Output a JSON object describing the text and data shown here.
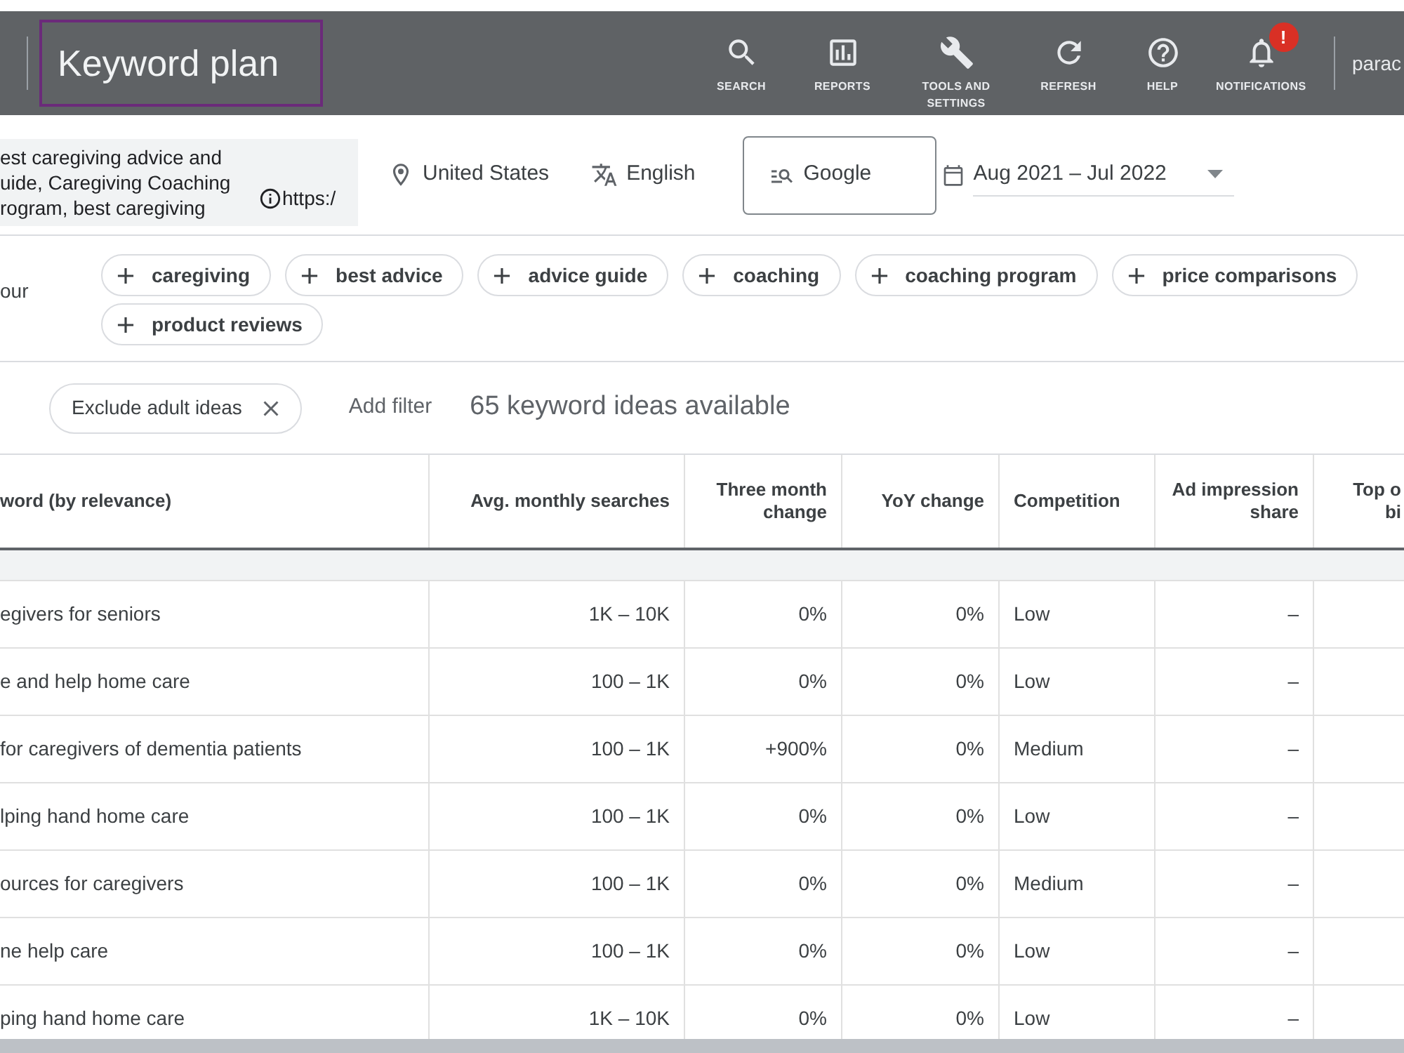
{
  "header": {
    "title": "Keyword plan",
    "nav": [
      {
        "kind": "search",
        "label": "SEARCH"
      },
      {
        "kind": "reports",
        "label": "REPORTS"
      },
      {
        "kind": "tools",
        "label": "TOOLS AND SETTINGS"
      },
      {
        "kind": "refresh",
        "label": "REFRESH"
      },
      {
        "kind": "help",
        "label": "HELP"
      },
      {
        "kind": "notifications",
        "label": "NOTIFICATIONS",
        "badge": "!"
      }
    ],
    "account": "parac"
  },
  "settings": {
    "keywords": [
      "est caregiving advice and",
      "uide, Caregiving Coaching",
      "rogram, best caregiving"
    ],
    "url": "https:/",
    "location": "United States",
    "language": "English",
    "network": "Google",
    "date_range": "Aug 2021 – Jul 2022"
  },
  "refine": {
    "label": "our",
    "chips": [
      "caregiving",
      "best advice",
      "advice guide",
      "coaching",
      "coaching program",
      "price comparisons",
      "product reviews"
    ]
  },
  "filters": {
    "chips": [
      "Exclude adult ideas"
    ],
    "add_filter": "Add filter",
    "count": "65 keyword ideas available"
  },
  "table": {
    "columns": [
      {
        "label": "word (by relevance)",
        "kind": "text"
      },
      {
        "label": "Avg. monthly searches",
        "kind": "number"
      },
      {
        "label": "Three month change",
        "kind": "number"
      },
      {
        "label": "YoY change",
        "kind": "number"
      },
      {
        "label": "Competition",
        "kind": "text"
      },
      {
        "label": "Ad impression share",
        "kind": "number"
      },
      {
        "label": "Top o bi",
        "kind": "number"
      }
    ],
    "rows": [
      [
        "egivers for seniors",
        "1K – 10K",
        "0%",
        "0%",
        "Low",
        "–"
      ],
      [
        "e and help home care",
        "100 – 1K",
        "0%",
        "0%",
        "Low",
        "–"
      ],
      [
        "for caregivers of dementia patients",
        "100 – 1K",
        "+900%",
        "0%",
        "Medium",
        "–"
      ],
      [
        "lping hand home care",
        "100 – 1K",
        "0%",
        "0%",
        "Low",
        "–"
      ],
      [
        "ources for caregivers",
        "100 – 1K",
        "0%",
        "0%",
        "Medium",
        "–"
      ],
      [
        "ne help care",
        "100 – 1K",
        "0%",
        "0%",
        "Low",
        "–"
      ],
      [
        "ping hand home care",
        "1K – 10K",
        "0%",
        "0%",
        "Low",
        "–"
      ]
    ]
  }
}
